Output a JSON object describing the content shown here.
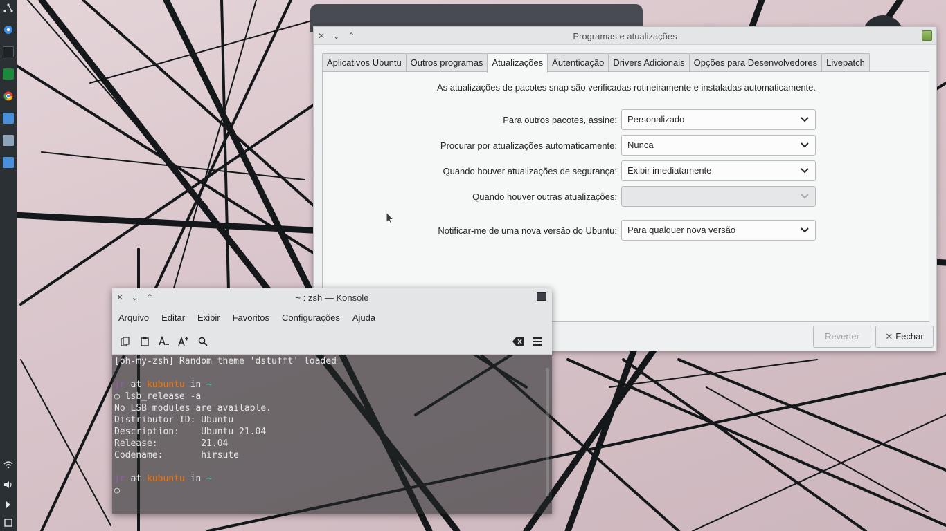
{
  "prog_window": {
    "title": "Programas e atualizações",
    "tabs": [
      {
        "label": "Aplicativos Ubuntu",
        "active": false
      },
      {
        "label": "Outros programas",
        "active": false
      },
      {
        "label": "Atualizações",
        "active": true
      },
      {
        "label": "Autenticação",
        "active": false
      },
      {
        "label": "Drivers Adicionais",
        "active": false
      },
      {
        "label": "Opções para Desenvolvedores",
        "active": false
      },
      {
        "label": "Livepatch",
        "active": false
      }
    ],
    "snap_info": "As atualizações de pacotes snap são verificadas rotineiramente e instaladas automaticamente.",
    "rows": [
      {
        "label": "Para outros pacotes, assine:",
        "value": "Personalizado",
        "enabled": true
      },
      {
        "label": "Procurar por atualizações automaticamente:",
        "value": "Nunca",
        "enabled": true
      },
      {
        "label": "Quando houver atualizações de segurança:",
        "value": "Exibir imediatamente",
        "enabled": true
      },
      {
        "label": "Quando houver outras atualizações:",
        "value": "",
        "enabled": false
      },
      {
        "label": "Notificar-me de uma nova versão do Ubuntu:",
        "value": "Para qualquer nova versão",
        "enabled": true
      }
    ],
    "buttons": {
      "revert": "Reverter",
      "close": "Fechar"
    }
  },
  "konsole": {
    "title": "~ : zsh — Konsole",
    "menu": [
      "Arquivo",
      "Editar",
      "Exibir",
      "Favoritos",
      "Configurações",
      "Ajuda"
    ],
    "toolbar_icons": [
      "copy-icon",
      "paste-icon",
      "decrease-font-icon",
      "increase-font-icon",
      "find-icon",
      "clear-icon",
      "hamburger-menu-icon"
    ],
    "terminal": {
      "theme_line": "[oh-my-zsh] Random theme 'dstufft' loaded",
      "prompt": {
        "user": "jr",
        "at": " at ",
        "host": "kubuntu",
        "in": " in ",
        "dir": "~"
      },
      "command_line": "○ lsb_release -a",
      "output": [
        "No LSB modules are available.",
        "Distributor ID: Ubuntu",
        "Description:    Ubuntu 21.04",
        "Release:        21.04",
        "Codename:       hirsute"
      ],
      "empty_prompt": "○"
    }
  },
  "colors": {
    "panel": "#2b3035",
    "window_bg": "#eff0f1",
    "term_user": "#9b59b6",
    "term_host": "#f67400",
    "term_dir": "#1cdc9a"
  }
}
